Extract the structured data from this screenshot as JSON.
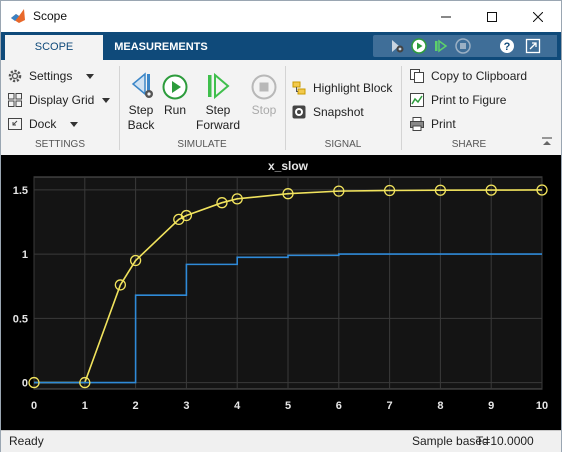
{
  "window": {
    "title": "Scope",
    "minimize": "minimize-icon",
    "maximize": "maximize-icon",
    "close": "close-icon"
  },
  "tabs": [
    {
      "label": "SCOPE",
      "active": true
    },
    {
      "label": "MEASUREMENTS",
      "active": false
    }
  ],
  "quick_access": [
    "settings-run-icon",
    "run-icon",
    "step-forward-icon",
    "stop-icon",
    "help-icon",
    "undock-icon"
  ],
  "toolstrip": {
    "settings": {
      "section": "SETTINGS",
      "settings_label": "Settings",
      "display_grid_label": "Display Grid",
      "dock_label": "Dock"
    },
    "simulate": {
      "section": "SIMULATE",
      "step_back": [
        "Step",
        "Back"
      ],
      "run": "Run",
      "step_forward": [
        "Step",
        "Forward"
      ],
      "stop": "Stop"
    },
    "signal": {
      "section": "SIGNAL",
      "highlight_block": "Highlight Block",
      "snapshot": "Snapshot"
    },
    "share": {
      "section": "SHARE",
      "copy_clipboard": "Copy to Clipboard",
      "print_figure": "Print to Figure",
      "print": "Print"
    }
  },
  "chart_data": {
    "type": "line",
    "title": "x_slow",
    "xlabel": "",
    "ylabel": "",
    "xlim": [
      0,
      10
    ],
    "ylim": [
      -0.05,
      1.6
    ],
    "xticks": [
      0,
      1,
      2,
      3,
      4,
      5,
      6,
      7,
      8,
      9,
      10
    ],
    "yticks": [
      0,
      0.5,
      1,
      1.5
    ],
    "ytick_labels": [
      "0",
      "0.5",
      "1",
      "1.5"
    ],
    "grid": true,
    "background": "#000000",
    "axes_background": "#141414",
    "series": [
      {
        "color": "#f1e35d",
        "style": "line-with-circles",
        "x": [
          0,
          1,
          1.7,
          2,
          2.85,
          3,
          3.7,
          4,
          5,
          6,
          7,
          8,
          9,
          10
        ],
        "y": [
          0,
          0,
          0.76,
          0.95,
          1.27,
          1.3,
          1.4,
          1.43,
          1.47,
          1.49,
          1.495,
          1.497,
          1.498,
          1.499
        ]
      },
      {
        "color": "#2f8ad8",
        "style": "stairs",
        "x": [
          0,
          2,
          3,
          4,
          5,
          6,
          7,
          8,
          9,
          10
        ],
        "y": [
          0,
          0.68,
          0.92,
          0.975,
          0.99,
          1.0,
          1.0,
          1.0,
          1.0,
          1.0
        ]
      }
    ]
  },
  "status": {
    "left": "Ready",
    "mode": "Sample based",
    "time": "T=10.0000"
  }
}
